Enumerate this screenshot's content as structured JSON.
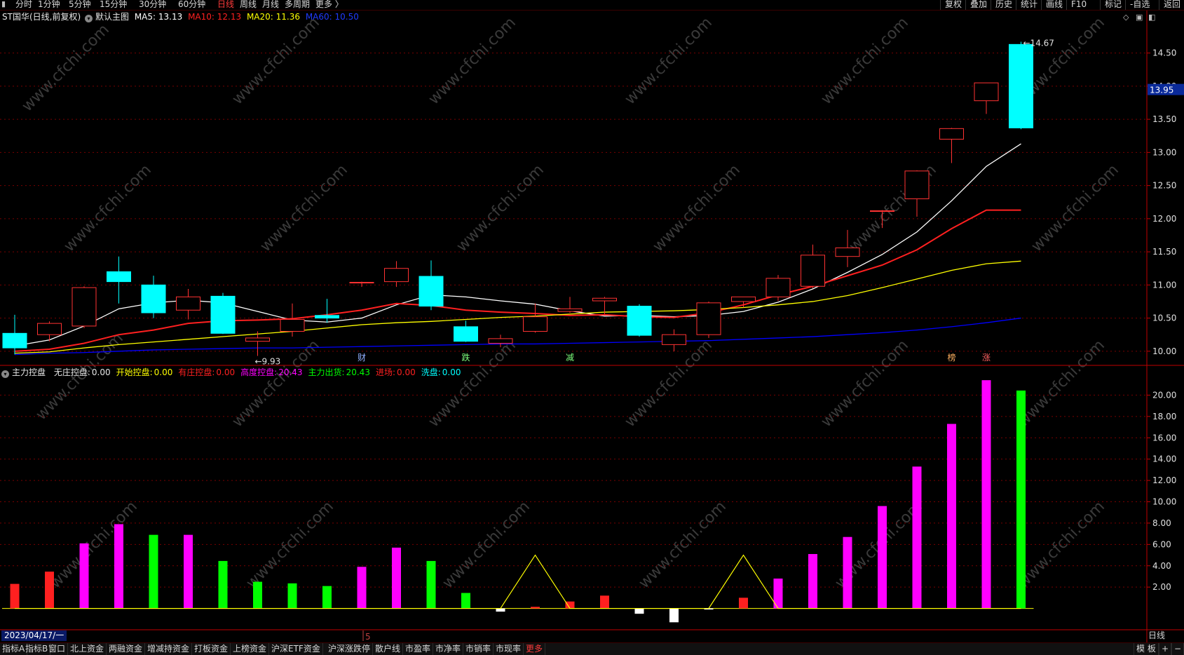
{
  "topbar": {
    "periods": [
      "分时",
      "1分钟",
      "5分钟",
      "15分钟",
      "30分钟",
      "60分钟",
      "日线",
      "周线",
      "月线",
      "多周期",
      "更多 〉"
    ],
    "active_period": "日线",
    "right_tools": [
      "复权",
      "叠加",
      "历史",
      "统计",
      "画线",
      "F10",
      "标记",
      "-自选",
      "返回"
    ]
  },
  "price_header": {
    "stock_title": "ST国华(日线,前复权)",
    "main_chart_label": "默认主图",
    "ma5": "MA5: 13.13",
    "ma10": "MA10: 12.13",
    "ma20": "MA20: 11.36",
    "ma60": "MA60: 10.50"
  },
  "indicator_header": {
    "name": "主力控盘",
    "items": [
      {
        "label": "无庄控盘:",
        "value": "0.00",
        "color": "#e6e6e6"
      },
      {
        "label": "开始控盘:",
        "value": "0.00",
        "color": "#ffff00"
      },
      {
        "label": "有庄控盘:",
        "value": "0.00",
        "color": "#ff2020"
      },
      {
        "label": "高度控盘:",
        "value": "20.43",
        "color": "#ff00ff"
      },
      {
        "label": "主力出货:",
        "value": "20.43",
        "color": "#00ff00"
      },
      {
        "label": "进场:",
        "value": "0.00",
        "color": "#ff2020"
      },
      {
        "label": "洗盘:",
        "value": "0.00",
        "color": "#00ffff"
      }
    ]
  },
  "chart_data": {
    "type": "candlestick+bar",
    "price_axis": {
      "ticks": [
        "14.50",
        "14.00",
        "13.50",
        "13.00",
        "12.50",
        "12.00",
        "11.50",
        "11.00",
        "10.50",
        "10.00"
      ],
      "current_price": "13.95",
      "ylim": [
        9.85,
        14.75
      ]
    },
    "indicator_axis": {
      "ticks": [
        "20.00",
        "18.00",
        "16.00",
        "14.00",
        "12.00",
        "10.00",
        "8.00",
        "6.00",
        "4.00",
        "2.00"
      ],
      "ylim": [
        -2,
        22
      ]
    },
    "high_label": "14.67",
    "low_label": "9.93",
    "candles": [
      {
        "o": 10.27,
        "h": 10.55,
        "l": 9.95,
        "c": 10.05
      },
      {
        "o": 10.25,
        "h": 10.45,
        "l": 10.15,
        "c": 10.42
      },
      {
        "o": 10.38,
        "h": 10.98,
        "l": 10.35,
        "c": 10.96
      },
      {
        "o": 11.2,
        "h": 11.43,
        "l": 10.72,
        "c": 11.05
      },
      {
        "o": 11.0,
        "h": 11.14,
        "l": 10.5,
        "c": 10.58
      },
      {
        "o": 10.62,
        "h": 10.94,
        "l": 10.48,
        "c": 10.82
      },
      {
        "o": 10.83,
        "h": 10.88,
        "l": 10.26,
        "c": 10.27
      },
      {
        "o": 10.15,
        "h": 10.3,
        "l": 9.93,
        "c": 10.2
      },
      {
        "o": 10.3,
        "h": 10.72,
        "l": 10.22,
        "c": 10.48
      },
      {
        "o": 10.54,
        "h": 10.79,
        "l": 10.43,
        "c": 10.5
      },
      {
        "o": 11.03,
        "h": 11.05,
        "l": 10.97,
        "c": 11.04
      },
      {
        "o": 11.05,
        "h": 11.36,
        "l": 10.97,
        "c": 11.25
      },
      {
        "o": 11.13,
        "h": 11.37,
        "l": 10.62,
        "c": 10.68
      },
      {
        "o": 10.37,
        "h": 10.46,
        "l": 10.14,
        "c": 10.15
      },
      {
        "o": 10.12,
        "h": 10.25,
        "l": 10.06,
        "c": 10.19
      },
      {
        "o": 10.3,
        "h": 10.72,
        "l": 10.28,
        "c": 10.52
      },
      {
        "o": 10.6,
        "h": 10.82,
        "l": 10.58,
        "c": 10.64
      },
      {
        "o": 10.76,
        "h": 10.82,
        "l": 10.56,
        "c": 10.8
      },
      {
        "o": 10.68,
        "h": 10.71,
        "l": 10.22,
        "c": 10.24
      },
      {
        "o": 10.1,
        "h": 10.33,
        "l": 10.0,
        "c": 10.25
      },
      {
        "o": 10.25,
        "h": 10.75,
        "l": 10.2,
        "c": 10.73
      },
      {
        "o": 10.75,
        "h": 10.82,
        "l": 10.66,
        "c": 10.82
      },
      {
        "o": 10.82,
        "h": 11.15,
        "l": 10.76,
        "c": 11.1
      },
      {
        "o": 10.98,
        "h": 11.61,
        "l": 10.95,
        "c": 11.45
      },
      {
        "o": 11.43,
        "h": 11.83,
        "l": 11.27,
        "c": 11.56
      },
      {
        "o": 12.11,
        "h": 12.13,
        "l": 11.86,
        "c": 12.12
      },
      {
        "o": 12.3,
        "h": 12.73,
        "l": 12.03,
        "c": 12.72
      },
      {
        "o": 13.2,
        "h": 13.37,
        "l": 12.84,
        "c": 13.36
      },
      {
        "o": 13.78,
        "h": 14.05,
        "l": 13.58,
        "c": 14.05
      },
      {
        "o": 14.63,
        "h": 14.67,
        "l": 13.35,
        "c": 13.37
      }
    ],
    "series": [
      {
        "name": "MA5",
        "color": "#ffffff",
        "values": [
          10.08,
          10.17,
          10.38,
          10.64,
          10.73,
          10.77,
          10.73,
          10.6,
          10.47,
          10.44,
          10.5,
          10.7,
          10.85,
          10.82,
          10.76,
          10.71,
          10.61,
          10.53,
          10.54,
          10.52,
          10.54,
          10.6,
          10.74,
          10.94,
          11.19,
          11.46,
          11.8,
          12.27,
          12.79,
          13.13
        ]
      },
      {
        "name": "MA10",
        "color": "#ff2020",
        "values": [
          10.0,
          10.03,
          10.12,
          10.25,
          10.32,
          10.42,
          10.46,
          10.47,
          10.49,
          10.55,
          10.62,
          10.72,
          10.69,
          10.62,
          10.59,
          10.57,
          10.54,
          10.55,
          10.52,
          10.51,
          10.58,
          10.7,
          10.85,
          10.98,
          11.14,
          11.3,
          11.53,
          11.85,
          12.13,
          12.13
        ]
      },
      {
        "name": "MA20",
        "color": "#ffff00",
        "values": [
          9.97,
          9.99,
          10.05,
          10.1,
          10.14,
          10.18,
          10.22,
          10.26,
          10.3,
          10.35,
          10.4,
          10.43,
          10.45,
          10.48,
          10.51,
          10.53,
          10.56,
          10.59,
          10.6,
          10.61,
          10.63,
          10.66,
          10.7,
          10.75,
          10.84,
          10.96,
          11.09,
          11.22,
          11.32,
          11.36
        ]
      },
      {
        "name": "MA60",
        "color": "#0000ff",
        "values": [
          9.95,
          9.97,
          9.98,
          10.0,
          10.02,
          10.03,
          10.04,
          10.05,
          10.05,
          10.06,
          10.07,
          10.08,
          10.09,
          10.1,
          10.11,
          10.11,
          10.12,
          10.13,
          10.14,
          10.15,
          10.16,
          10.18,
          10.2,
          10.22,
          10.25,
          10.28,
          10.32,
          10.37,
          10.43,
          10.5
        ]
      }
    ],
    "indicator_bars": [
      {
        "v": 2.3,
        "c": "#ff2020"
      },
      {
        "v": 3.45,
        "c": "#ff2020"
      },
      {
        "v": 6.1,
        "c": "#ff00ff"
      },
      {
        "v": 7.9,
        "c": "#ff00ff"
      },
      {
        "v": 6.9,
        "c": "#00ff00"
      },
      {
        "v": 6.9,
        "c": "#ff00ff"
      },
      {
        "v": 4.45,
        "c": "#00ff00"
      },
      {
        "v": 2.5,
        "c": "#00ff00"
      },
      {
        "v": 2.35,
        "c": "#00ff00"
      },
      {
        "v": 2.1,
        "c": "#00ff00"
      },
      {
        "v": 3.9,
        "c": "#ff00ff"
      },
      {
        "v": 5.7,
        "c": "#ff00ff"
      },
      {
        "v": 4.45,
        "c": "#00ff00"
      },
      {
        "v": 1.45,
        "c": "#00ff00"
      },
      {
        "v": -0.3,
        "c": "#ffffff"
      },
      {
        "v": 0.15,
        "c": "#ff2020"
      },
      {
        "v": 0.65,
        "c": "#ff2020"
      },
      {
        "v": 1.2,
        "c": "#ff2020"
      },
      {
        "v": -0.5,
        "c": "#ffffff"
      },
      {
        "v": -1.3,
        "c": "#ffffff"
      },
      {
        "v": 0.0,
        "c": "#ffffff"
      },
      {
        "v": 1.0,
        "c": "#ff2020"
      },
      {
        "v": 2.8,
        "c": "#ff00ff"
      },
      {
        "v": 5.1,
        "c": "#ff00ff"
      },
      {
        "v": 6.7,
        "c": "#ff00ff"
      },
      {
        "v": 9.6,
        "c": "#ff00ff"
      },
      {
        "v": 13.3,
        "c": "#ff00ff"
      },
      {
        "v": 17.3,
        "c": "#ff00ff"
      },
      {
        "v": 21.4,
        "c": "#ff00ff"
      },
      {
        "v": 20.43,
        "c": "#00ff00"
      }
    ],
    "yellow_line": [
      0,
      0,
      0,
      0,
      0,
      0,
      0,
      0,
      0,
      0,
      0,
      0,
      0,
      0,
      0,
      5.0,
      0,
      0,
      0,
      0,
      0,
      5.0,
      0,
      0,
      0,
      0,
      0,
      0,
      0,
      0
    ],
    "event_markers": [
      {
        "index": 10,
        "text": "财",
        "color": "#8fb0ff"
      },
      {
        "index": 13,
        "text": "跌",
        "color": "#7dff7d"
      },
      {
        "index": 16,
        "text": "减",
        "color": "#7dff7d"
      },
      {
        "index": 27,
        "text": "榜",
        "color": "#ffb060"
      },
      {
        "index": 28,
        "text": "涨",
        "color": "#ff6060"
      }
    ],
    "axis_marker_5": "5"
  },
  "datebar": {
    "date": "2023/04/17/一",
    "period": "日线"
  },
  "bottombar": {
    "items": [
      "指标A",
      "指标B",
      "窗口",
      "北上资金",
      "两融资金",
      "增减持资金",
      "打板资金",
      "上榜资金",
      "沪深ETF资金",
      "沪深涨跌停",
      "散户线",
      "市盈率",
      "市净率",
      "市销率",
      "市现率",
      "更多"
    ],
    "right_items": [
      "模 板",
      "+",
      "−"
    ]
  },
  "watermark": "www.cfchi.com",
  "colors": {
    "up": "#ff3232",
    "down": "#00ffff",
    "grid": "#7a0000",
    "axis": "#c00000"
  }
}
